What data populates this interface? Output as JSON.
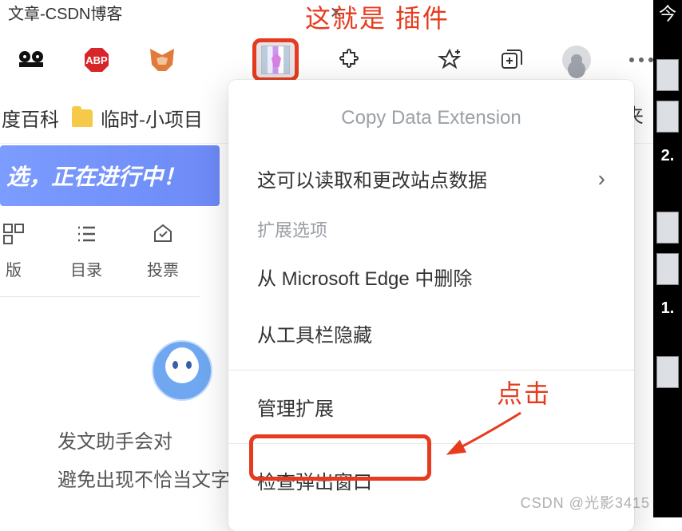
{
  "tab": {
    "title_fragment": "文章-CSDN博客",
    "close_glyph": "×"
  },
  "annotations": {
    "top": "这就是 插件",
    "click": "点击"
  },
  "bookmarks": {
    "item1": "度百科",
    "item2": "临时-小项目",
    "right_fragment": "藏夹"
  },
  "banner": "选，正在进行中！",
  "tools": {
    "ban": "版",
    "toc": "目录",
    "vote": "投票"
  },
  "content": {
    "line1": "发文助手会对",
    "line2": "避免出现不恰当文字从而影响文章"
  },
  "context_menu": {
    "title": "Copy Data Extension",
    "read_change": "这可以读取和更改站点数据",
    "section": "扩展选项",
    "remove": "从 Microsoft Edge 中删除",
    "hide": "从工具栏隐藏",
    "manage": "管理扩展",
    "inspect": "检查弹出窗口"
  },
  "dark_strip": {
    "n1": "2.",
    "n2": "1."
  },
  "watermark": "CSDN @光影3415"
}
